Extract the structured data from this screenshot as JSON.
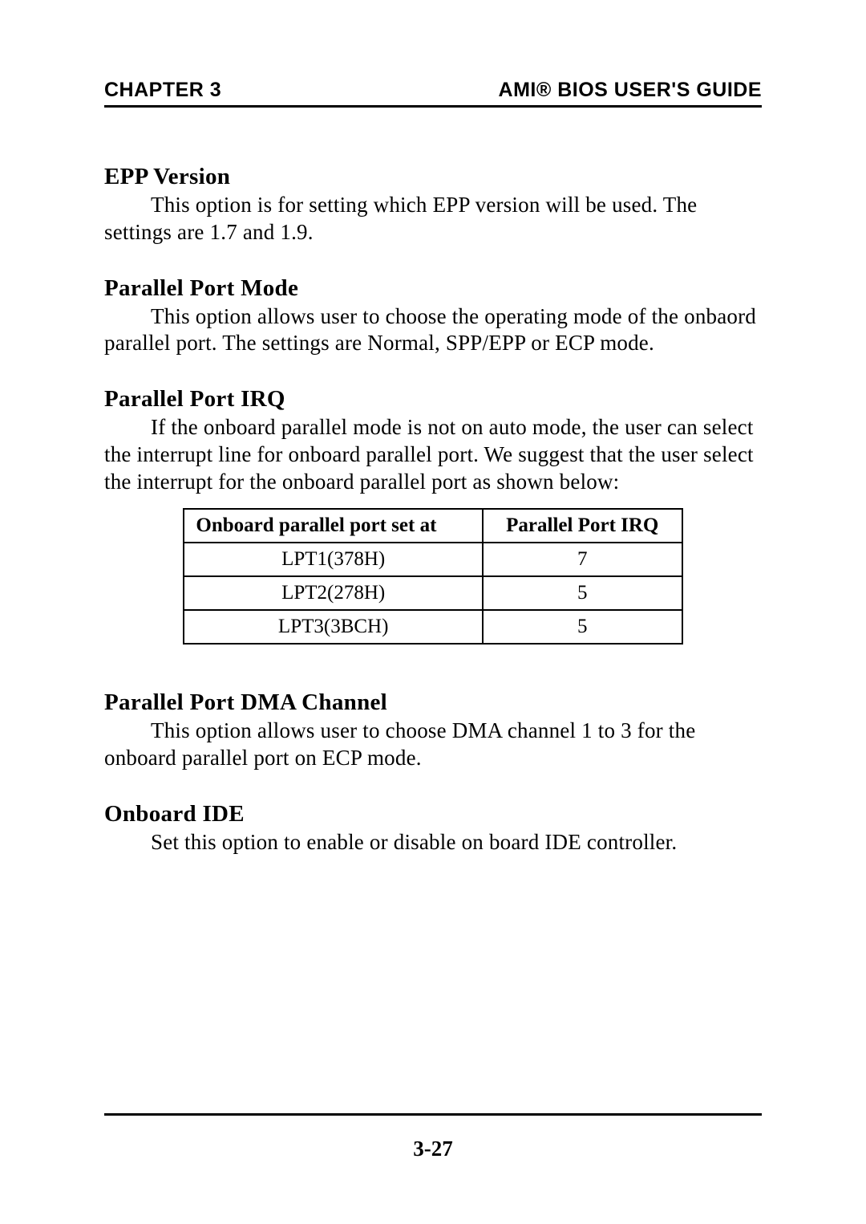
{
  "header": {
    "left": "CHAPTER 3",
    "right": "AMI® BIOS USER'S GUIDE"
  },
  "sections": {
    "epp_version": {
      "heading": "EPP  Version",
      "body": "This option is for setting which EPP version will be used.  The settings are 1.7 and 1.9."
    },
    "parallel_port_mode": {
      "heading": "Parallel Port Mode",
      "body": "This option allows user to choose the operating mode of the onbaord parallel port.  The settings are Normal, SPP/EPP or ECP mode."
    },
    "parallel_port_irq": {
      "heading": "Parallel Port IRQ",
      "body": "If the onboard parallel mode is not on auto mode, the user can select the interrupt line for onboard parallel port.  We suggest that the user select the interrupt for the onboard parallel port as shown below:"
    },
    "parallel_port_dma": {
      "heading": "Parallel Port DMA  Channel",
      "body": "This option allows user to choose DMA channel 1 to 3 for the onboard parallel port on ECP mode."
    },
    "onboard_ide": {
      "heading": "Onboard IDE",
      "body": "Set this option to enable or disable on board IDE controller."
    }
  },
  "table": {
    "col1_header": "Onboard parallel port set at",
    "col2_header": "Parallel Port IRQ",
    "rows": [
      {
        "port": "LPT1(378H)",
        "irq": "7"
      },
      {
        "port": "LPT2(278H)",
        "irq": "5"
      },
      {
        "port": "LPT3(3BCH)",
        "irq": "5"
      }
    ]
  },
  "page_number": "3-27"
}
